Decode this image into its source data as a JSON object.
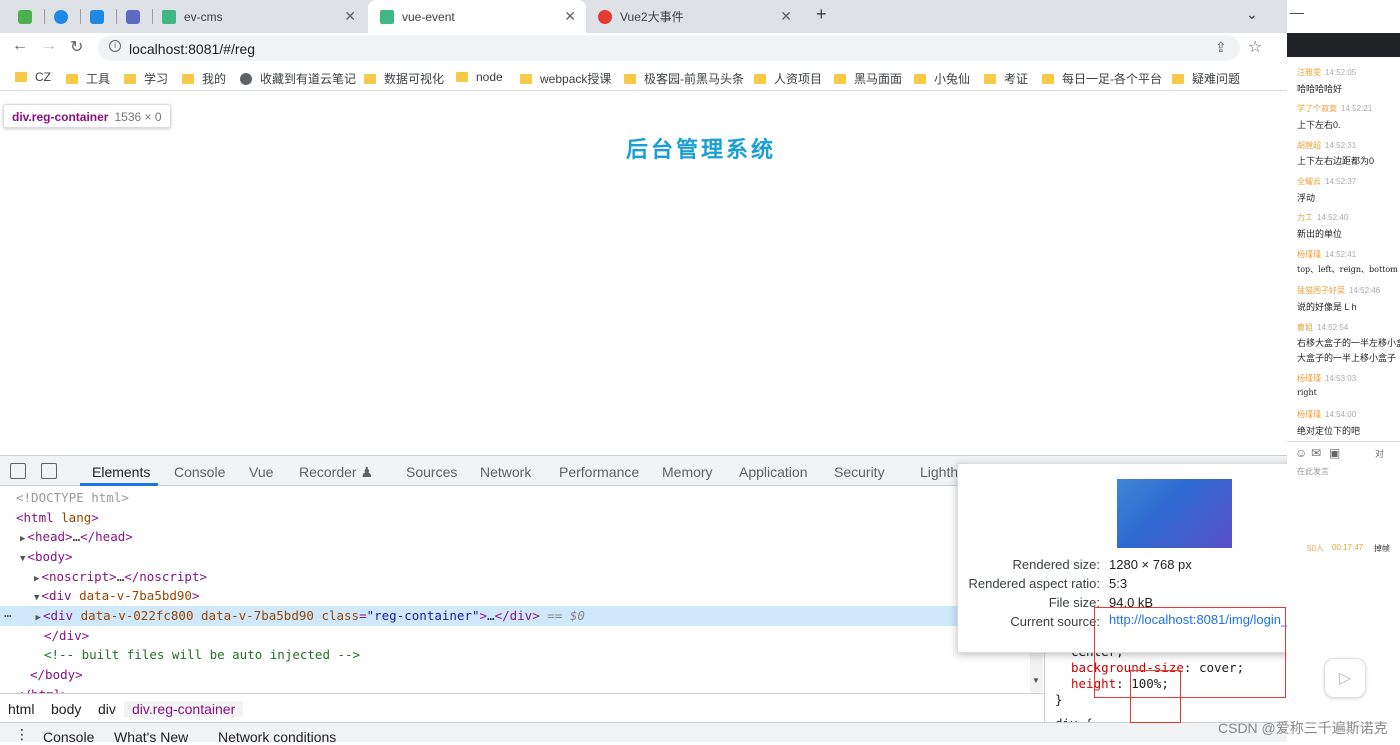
{
  "tabs": [
    {
      "label": "",
      "favicon": "green-hex-icon",
      "color": "#4caf50"
    },
    {
      "label": "",
      "favicon": "blue-circle-icon",
      "color": "#1e88e5"
    },
    {
      "label": "",
      "favicon": "blue-shield-icon",
      "color": "#1e88e5"
    },
    {
      "label": "",
      "favicon": "users-icon",
      "color": "#5c6bc0"
    },
    {
      "label": "ev-cms",
      "favicon": "vue-icon",
      "color": "#41b883"
    },
    {
      "label": "vue-event",
      "favicon": "vue-icon",
      "color": "#41b883"
    },
    {
      "label": "Vue2大事件",
      "favicon": "red-shield-icon",
      "color": "#e53935"
    }
  ],
  "address": {
    "url": "localhost:8081/#/reg"
  },
  "bookmarks": [
    {
      "label": "CZ"
    },
    {
      "label": "工具"
    },
    {
      "label": "学习"
    },
    {
      "label": "我的"
    },
    {
      "label": "收藏到有道云笔记"
    },
    {
      "label": "数据可视化"
    },
    {
      "label": "node"
    },
    {
      "label": "webpack授课"
    },
    {
      "label": "极客园-前黑马头条"
    },
    {
      "label": "人资项目"
    },
    {
      "label": "黑马面面"
    },
    {
      "label": "小兔仙"
    },
    {
      "label": "考证"
    },
    {
      "label": "每日一足-各个平台"
    },
    {
      "label": "疑难问题"
    }
  ],
  "page": {
    "tooltip_selector": "div.reg-container",
    "tooltip_size": "1536 × 0",
    "title": "后台管理系统"
  },
  "devtools": {
    "tabs": [
      "Elements",
      "Console",
      "Vue",
      "Recorder ♟",
      "Sources",
      "Network",
      "Performance",
      "Memory",
      "Application",
      "Security",
      "Lighth"
    ],
    "breadcrumbs": [
      "html",
      "body",
      "div",
      "div.reg-container"
    ],
    "drawer_tabs": [
      "Console",
      "What's New",
      "Network conditions"
    ],
    "styles_lines": [
      {
        "prop": "",
        "value": "center;"
      },
      {
        "prop": "background-size",
        "value": " cover;"
      },
      {
        "prop": "height",
        "value": " 100%;"
      },
      {
        "prop": "",
        "value": "}"
      },
      {
        "prop": "",
        "value": "div {"
      }
    ]
  },
  "image_preview": {
    "rendered_size_label": "Rendered size:",
    "rendered_size": "1280 × 768 px",
    "aspect_label": "Rendered aspect ratio:",
    "aspect": "5:3",
    "file_size_label": "File size:",
    "file_size": "94.0 kB",
    "source_label": "Current source:",
    "source": "http://localhost:8081/img/login_bg.09ea0026.jpg"
  },
  "chat": {
    "messages": [
      {
        "name": "汪雅雯",
        "time": "14:52:05",
        "text": "哈哈哈哈好"
      },
      {
        "name": "学了个寂寞",
        "time": "14:52:21",
        "text": "上下左右0."
      },
      {
        "name": "胡膛超",
        "time": "14:52:31",
        "text": "上下左右边距都为0"
      },
      {
        "name": "全耀云",
        "time": "14:52:37",
        "text": "浮动"
      },
      {
        "name": "力工",
        "time": "14:52:40",
        "text": "新出的单位"
      },
      {
        "name": "杨瑾瑾",
        "time": "14:52:41",
        "text": "top、left、reign、bottom"
      },
      {
        "name": "猛猫困子好菜",
        "time": "14:52:46",
        "text": "说的好像是  L  h"
      },
      {
        "name": "曹姐",
        "time": "14:52:54",
        "text": "右移大盒子的一半左移小盒"
      },
      {
        "name": "",
        "time": "",
        "text": "大盒子的一半上移小盒子"
      },
      {
        "name": "杨瑾瑾",
        "time": "14:53:03",
        "text": "right"
      },
      {
        "name": "杨瑾瑾",
        "time": "14:54:00",
        "text": "绝对定位下的吧"
      }
    ],
    "input_placeholder": "在此发言",
    "send_label": "对",
    "viewers": "50人",
    "duration": "00:17:47",
    "close_label": "掉帧"
  },
  "watermark": "CSDN @爱称三千遍斯诺克"
}
